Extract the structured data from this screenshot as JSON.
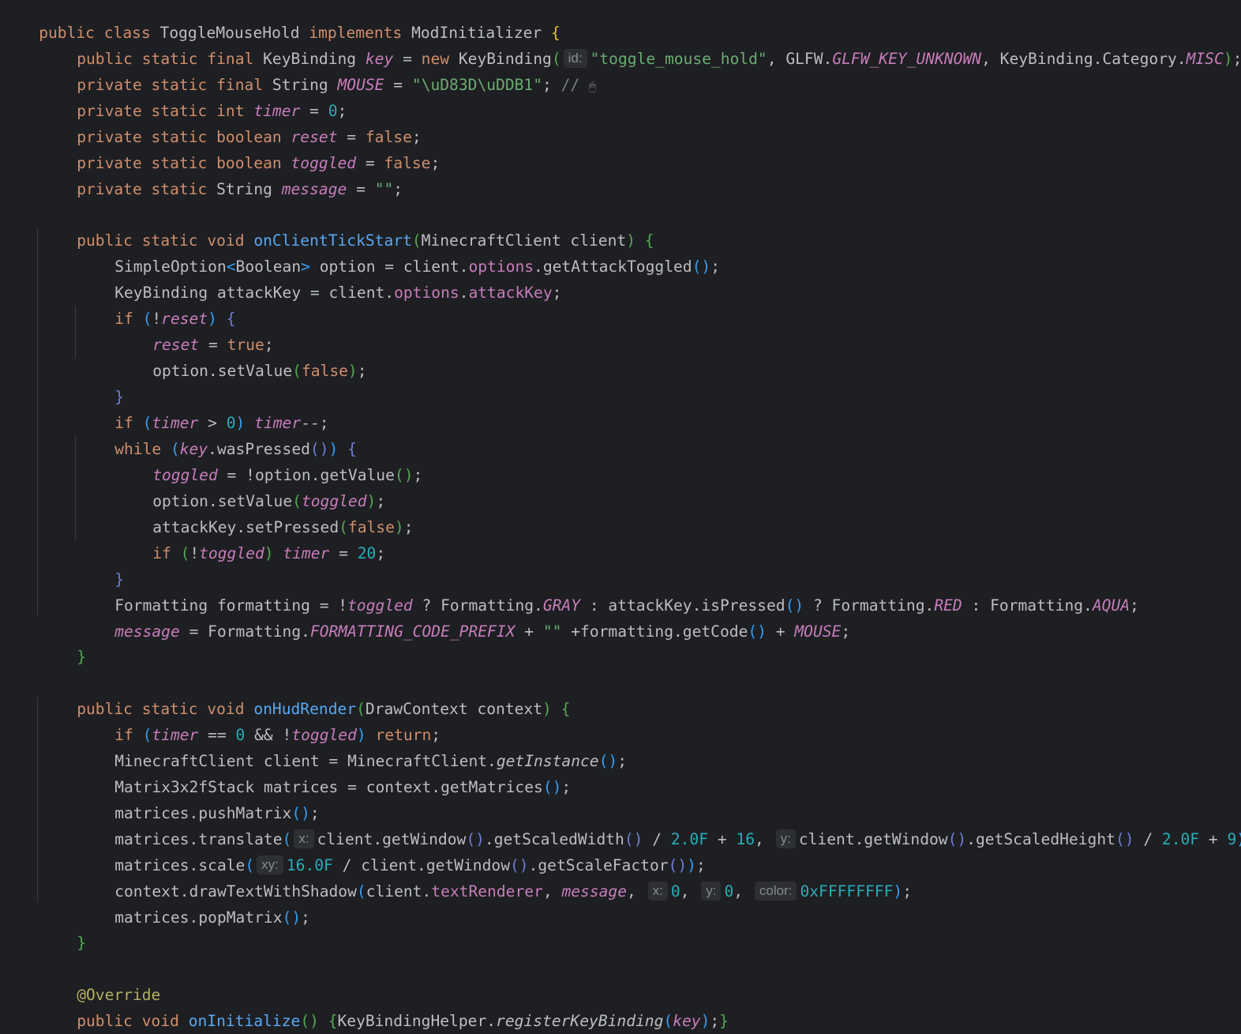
{
  "code": {
    "class_decl": {
      "kw_public": "public",
      "kw_class": "class",
      "name": "ToggleMouseHold",
      "kw_implements": "implements",
      "iface": "ModInitializer",
      "open": "{"
    },
    "l2": {
      "mods": "public static final",
      "type": "KeyBinding",
      "field": "key",
      "eq": "=",
      "kw_new": "new",
      "ctor": "KeyBinding",
      "open": "(",
      "hint_id": "id:",
      "arg1": "\"toggle_mouse_hold\"",
      "sep1": ",",
      "cls_glfw": "GLFW.",
      "glfw_const": "GLFW_KEY_UNKNOWN",
      "sep2": ",",
      "cat_path": "KeyBinding.Category.",
      "cat_const": "MISC",
      "close": ")",
      "semi": ";"
    },
    "l3": {
      "mods": "private static final",
      "type": "String",
      "field": "MOUSE",
      "eq": "=",
      "value": "\"\\uD83D\\uDDB1\"",
      "semi": ";",
      "comment": "// ",
      "comment_icon": "🖱"
    },
    "l4": {
      "mods": "private static",
      "type": "int",
      "field": "timer",
      "eq": "=",
      "value": "0",
      "semi": ";"
    },
    "l5": {
      "mods": "private static",
      "type": "boolean",
      "field": "reset",
      "eq": "=",
      "value": "false",
      "semi": ";"
    },
    "l6": {
      "mods": "private static",
      "type": "boolean",
      "field": "toggled",
      "eq": "=",
      "value": "false",
      "semi": ";"
    },
    "l7": {
      "mods": "private static",
      "type": "String",
      "field": "message",
      "eq": "=",
      "value": "\"\"",
      "semi": ";"
    },
    "l9": {
      "mods": "public static void",
      "name": "onClientTickStart",
      "open": "(",
      "params": "MinecraftClient client",
      "close": ")",
      "brace": "{"
    },
    "l10": {
      "type": "SimpleOption",
      "lt": "<",
      "generic": "Boolean",
      "gt": ">",
      "rest1": " option = client.",
      "field": "options",
      "rest2": ".getAttackToggled",
      "parens": "()",
      "semi": ";"
    },
    "l11": {
      "rest1": "KeyBinding attackKey = client.",
      "field1": "options",
      "dot": ".",
      "field2": "attackKey",
      "semi": ";"
    },
    "l12": {
      "kw": "if",
      "open": "(",
      "not": "!",
      "var": "reset",
      "close": ")",
      "brace": "{"
    },
    "l13": {
      "var": "reset",
      "eq": " = ",
      "value": "true",
      "semi": ";"
    },
    "l14": {
      "call": "option.setValue",
      "open": "(",
      "value": "false",
      "close": ")",
      "semi": ";"
    },
    "l15": {
      "brace": "}"
    },
    "l16": {
      "kw": "if",
      "open": "(",
      "var": "timer",
      "op": " > ",
      "num": "0",
      "close": ")",
      "var2": "timer",
      "rest": "--;"
    },
    "l17": {
      "kw": "while",
      "open": "(",
      "var": "key",
      "call": ".wasPressed",
      "parens": "()",
      "close": ")",
      "brace": "{"
    },
    "l18": {
      "var": "toggled",
      "rest": " = !option.getValue",
      "parens": "()",
      "semi": ";"
    },
    "l19": {
      "call": "option.setValue",
      "open": "(",
      "var": "toggled",
      "close": ")",
      "semi": ";"
    },
    "l20": {
      "call": "attackKey.setPressed",
      "open": "(",
      "value": "false",
      "close": ")",
      "semi": ";"
    },
    "l21": {
      "kw": "if",
      "open": "(",
      "not": "!",
      "var": "toggled",
      "close": ")",
      "var2": "timer",
      "eq": " = ",
      "num": "20",
      "semi": ";"
    },
    "l22": {
      "brace": "}"
    },
    "l23": {
      "rest1": "Formatting formatting = !",
      "var": "toggled",
      "rest2": " ? Formatting.",
      "c1": "GRAY",
      "rest3": " : attackKey.isPressed",
      "parens": "()",
      "rest4": " ? Formatting.",
      "c2": "RED",
      "rest5": " : Formatting.",
      "c3": "AQUA",
      "semi": ";"
    },
    "l24": {
      "var": "message",
      "rest1": " = Formatting.",
      "c1": "FORMATTING_CODE_PREFIX",
      "rest2": " + ",
      "str": "\"\"",
      "rest3": " +formatting.getCode",
      "parens": "()",
      "rest4": " + ",
      "c2": "MOUSE",
      "semi": ";"
    },
    "l25": {
      "brace": "}"
    },
    "l27": {
      "mods": "public static void",
      "name": "onHudRender",
      "open": "(",
      "params": "DrawContext context",
      "close": ")",
      "brace": "{"
    },
    "l28": {
      "kw": "if",
      "open": "(",
      "var": "timer",
      "op": " == ",
      "num": "0",
      "and": " && !",
      "var2": "toggled",
      "close": ")",
      "kw2": "return",
      "semi": ";"
    },
    "l29": {
      "rest1": "MinecraftClient client = MinecraftClient.",
      "call": "getInstance",
      "parens": "()",
      "semi": ";"
    },
    "l30": {
      "rest1": "Matrix3x2fStack matrices = context.getMatrices",
      "parens": "()",
      "semi": ";"
    },
    "l31": {
      "rest1": "matrices.pushMatrix",
      "parens": "()",
      "semi": ";"
    },
    "l32": {
      "rest1": "matrices.translate",
      "open": "(",
      "hint_x": "x:",
      "a1": "client.getWindow",
      "p1": "()",
      "a2": ".getScaledWidth",
      "p2": "()",
      "op1": " / ",
      "n1": "2.0F",
      "op2": " + ",
      "n2": "16",
      "sep": ",",
      "hint_y": "y:",
      "b1": "client.getWindow",
      "p3": "()",
      "b2": ".getScaledHeight",
      "p4": "()",
      "op3": " / ",
      "n3": "2.0F",
      "op4": " + ",
      "n4": "9",
      "close": ")",
      "semi": ";"
    },
    "l33": {
      "rest1": "matrices.scale",
      "open": "(",
      "hint_xy": "xy:",
      "n1": "16.0F",
      "rest2": " / client.getWindow",
      "p1": "()",
      "rest3": ".getScaleFactor",
      "p2": "()",
      "close": ")",
      "semi": ";"
    },
    "l34": {
      "rest1": "context.drawTextWithShadow",
      "open": "(",
      "a1": "client.",
      "field": "textRenderer",
      "sep1": ", ",
      "var": "message",
      "sep2": ",",
      "hint_x": "x:",
      "n1": "0",
      "sep3": ",",
      "hint_y": "y:",
      "n2": "0",
      "sep4": ",",
      "hint_color": "color:",
      "n3": "0xFFFFFFFF",
      "close": ")",
      "semi": ";"
    },
    "l35": {
      "rest1": "matrices.popMatrix",
      "parens": "()",
      "semi": ";"
    },
    "l36": {
      "brace": "}"
    },
    "l38": {
      "annotation": "@Override"
    },
    "l39": {
      "mods": "public void",
      "name": "onInitialize",
      "parens": "()",
      "open_brace": "{",
      "rest1": "KeyBindingHelper.",
      "call": "registerKeyBinding",
      "open": "(",
      "var": "key",
      "close": ")",
      "semi": ";",
      "close_brace": "}"
    },
    "l40": {
      "brace": "}"
    }
  }
}
